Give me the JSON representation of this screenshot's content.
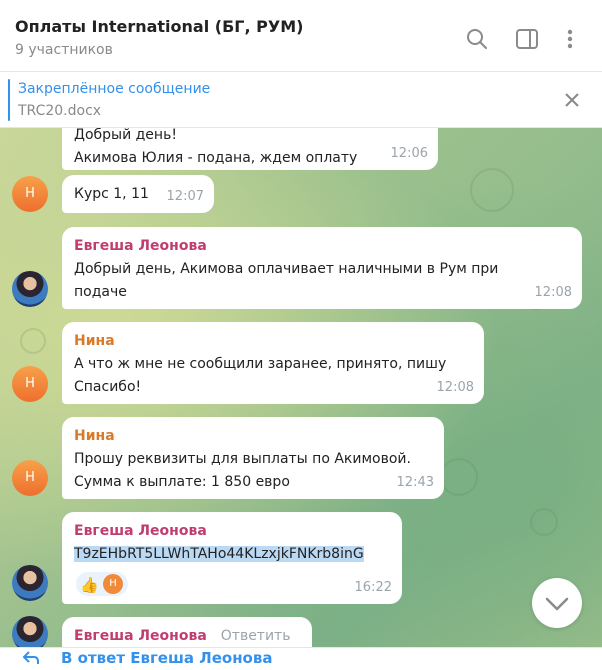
{
  "header": {
    "title": "Оплаты International (БГ, РУМ)",
    "subtitle": "9 участников"
  },
  "pinned": {
    "label": "Закреплённое сообщение",
    "file": "TRC20.docx"
  },
  "messages": [
    {
      "sender": "",
      "lines": [
        "Добрый день!",
        "Акимова Юлия - подана, ждем оплату"
      ],
      "time": "12:06"
    },
    {
      "sender": "",
      "lines": [
        "Курс 1, 11"
      ],
      "time": "12:07"
    },
    {
      "sender": "Евгеша Леонова",
      "lines": [
        "Добрый день, Акимова оплачивает наличными в Рум при",
        "подаче"
      ],
      "time": "12:08"
    },
    {
      "sender": "Нина",
      "lines": [
        "А что ж мне не сообщили заранее, принято, пишу",
        "Спасибо!"
      ],
      "time": "12:08"
    },
    {
      "sender": "Нина",
      "lines": [
        "Прошу реквизиты для выплаты по Акимовой.",
        "Сумма к выплате: 1 850 евро"
      ],
      "time": "12:43"
    },
    {
      "sender": "Евгеша Леонова",
      "lines": [
        "T9zEHbRT5LLWhTAHo44KLzxjkFNKrb8inG"
      ],
      "time": "16:22"
    },
    {
      "sender": "Евгеша Леонова",
      "reply_action": "Ответить"
    }
  ],
  "avatar_initial": "Н",
  "reaction": {
    "emoji": "👍",
    "avatar_initial": "Н"
  },
  "reply_bar": {
    "label": "В ответ Евгеша Леонова"
  },
  "colors": {
    "accent": "#3390ec",
    "name_pink": "#c03d6f",
    "name_orange": "#d97a2b"
  }
}
